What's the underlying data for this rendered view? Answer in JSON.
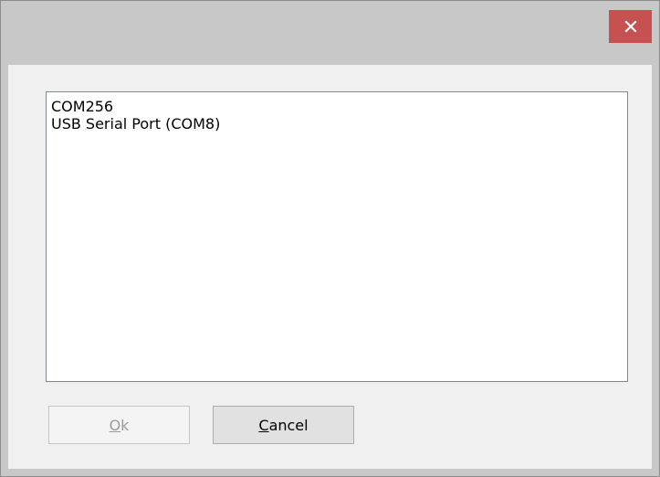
{
  "window": {
    "close_icon": "close-icon"
  },
  "ports": {
    "items": [
      "COM256",
      "USB Serial Port (COM8)"
    ]
  },
  "buttons": {
    "ok": {
      "mnemonic": "O",
      "rest": "k",
      "enabled": false
    },
    "cancel": {
      "mnemonic": "C",
      "rest": "ancel",
      "enabled": true
    }
  },
  "colors": {
    "close_button": "#c75050",
    "frame": "#c8c8c8",
    "client": "#f0f0f0"
  }
}
